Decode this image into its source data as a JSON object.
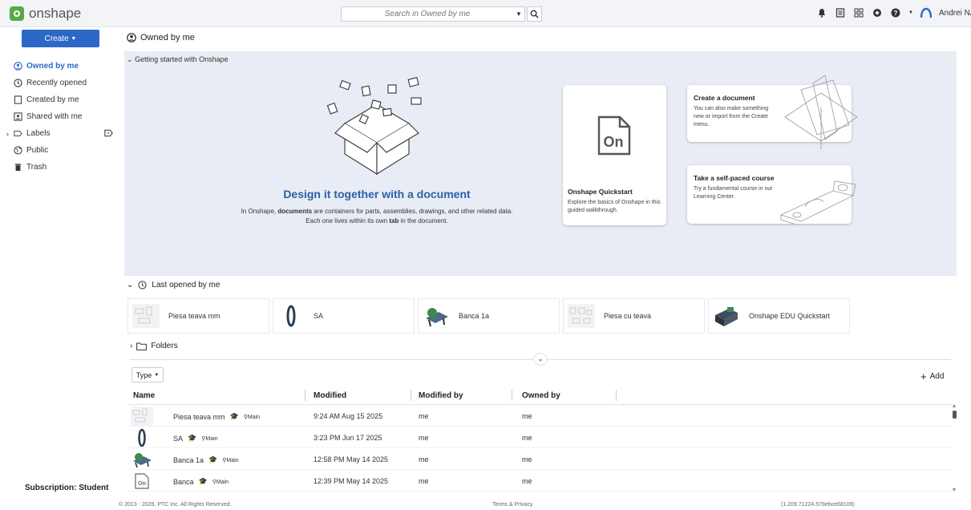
{
  "app": {
    "name": "onshape"
  },
  "search": {
    "placeholder": "Search in Owned by me"
  },
  "user": {
    "name": "Andrei NASTAS"
  },
  "sidebar": {
    "create_label": "Create",
    "items": [
      {
        "label": "Owned by me",
        "icon": "owner-icon"
      },
      {
        "label": "Recently opened",
        "icon": "clock-icon"
      },
      {
        "label": "Created by me",
        "icon": "document-icon"
      },
      {
        "label": "Shared with me",
        "icon": "shared-icon"
      },
      {
        "label": "Labels",
        "icon": "label-icon"
      },
      {
        "label": "Public",
        "icon": "globe-icon"
      },
      {
        "label": "Trash",
        "icon": "trash-icon"
      }
    ],
    "subscription": "Subscription: Student"
  },
  "main": {
    "title": "Owned by me",
    "getting_started": {
      "header": "Getting started with Onshape",
      "headline": "Design it together with a document",
      "desc_pre": "In Onshape, ",
      "desc_b1": "documents",
      "desc_mid": " are containers for parts, assemblies, drawings, and other related data. Each one lives within its own ",
      "desc_b2": "tab",
      "desc_post": " in the document.",
      "quickstart": {
        "title": "Onshape Quickstart",
        "text": "Explore the basics of Onshape in this guided walkthrough.",
        "logo": "On"
      },
      "create_doc": {
        "title": "Create a document",
        "text": "You can also make something new or import from the Create menu."
      },
      "course": {
        "title": "Take a self-paced course",
        "text": "Try a fundamental course in our Learning Center."
      }
    },
    "last_opened": {
      "label": "Last opened by me",
      "items": [
        "Piesa teava mm",
        "SA",
        "Banca 1a",
        "Piesa cu teava",
        "Onshape EDU Quickstart"
      ]
    },
    "folders_label": "Folders",
    "type_label": "Type",
    "add_label": "Add",
    "table": {
      "columns": [
        "Name",
        "Modified",
        "Modified by",
        "Owned by"
      ],
      "branch": "Main",
      "rows": [
        {
          "name": "Piesa teava mm",
          "modified": "9:24 AM Aug 15 2025",
          "modified_by": "me",
          "owned_by": "me"
        },
        {
          "name": "SA",
          "modified": "3:23 PM Jun 17 2025",
          "modified_by": "me",
          "owned_by": "me"
        },
        {
          "name": "Banca 1a",
          "modified": "12:58 PM May 14 2025",
          "modified_by": "me",
          "owned_by": "me"
        },
        {
          "name": "Banca",
          "modified": "12:39 PM May 14 2025",
          "modified_by": "me",
          "owned_by": "me"
        }
      ]
    }
  },
  "footer": {
    "copyright": "© 2013 - 2026, PTC Inc. All Rights Reserved.",
    "terms": "Terms & Privacy",
    "version": "(1.209.71224.578ebce68109)"
  },
  "colors": {
    "accent": "#2b68c8",
    "panel": "#e8ecf4",
    "brand": "#5aa845"
  }
}
